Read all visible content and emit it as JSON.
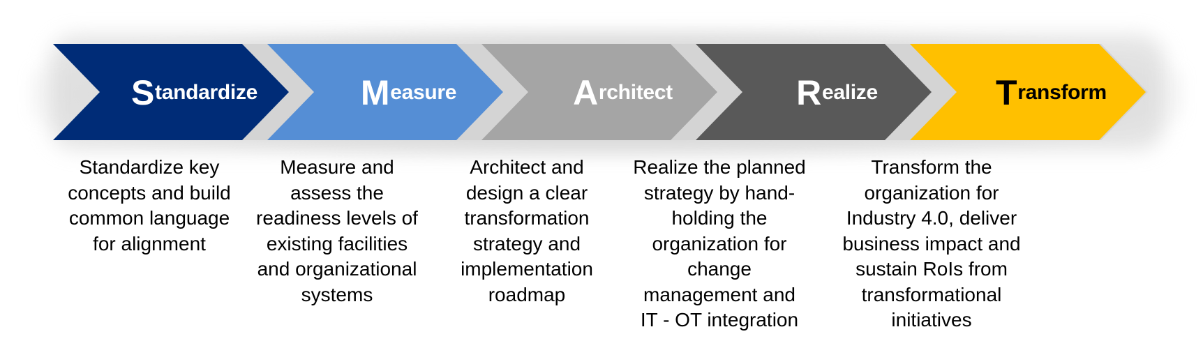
{
  "diagram": {
    "type": "process-chevron-flow",
    "steps": [
      {
        "initial": "S",
        "rest": "tandardize",
        "title": "Standardize",
        "fill": "#002C77",
        "text_color": "#FFFFFF",
        "description": "Standardize key concepts and build common language for alignment",
        "lines": [
          "Standardize key",
          "concepts and build",
          "common language",
          "for alignment"
        ]
      },
      {
        "initial": "M",
        "rest": "easure",
        "title": "Measure",
        "fill": "#558ED5",
        "text_color": "#FFFFFF",
        "description": "Measure and assess the readiness levels of existing facilities and organizational systems",
        "lines": [
          "Measure and",
          "assess the",
          "readiness levels of",
          "existing facilities",
          "and organizational",
          "systems"
        ]
      },
      {
        "initial": "A",
        "rest": "rchitect",
        "title": "Architect",
        "fill": "#A5A5A5",
        "text_color": "#FFFFFF",
        "description": "Architect and design a clear transformation strategy and implementation roadmap",
        "lines": [
          "Architect and",
          "design a clear",
          "transformation",
          "strategy and",
          "implementation",
          "roadmap"
        ]
      },
      {
        "initial": "R",
        "rest": "ealize",
        "title": "Realize",
        "fill": "#595959",
        "text_color": "#FFFFFF",
        "description": "Realize the planned strategy by hand-holding the organization for change management and IT - OT integration",
        "lines": [
          "Realize the planned",
          "strategy by hand-",
          "holding the",
          "organization for",
          "change",
          "management and",
          "IT - OT integration"
        ]
      },
      {
        "initial": "T",
        "rest": "ransform",
        "title": "Transform",
        "fill": "#FFC000",
        "text_color": "#000000",
        "description": "Transform the organization for Industry 4.0, deliver business impact and sustain RoIs from transformational initiatives",
        "lines": [
          "Transform the",
          "organization for",
          "Industry 4.0, deliver",
          "business impact and",
          "sustain RoIs from",
          "transformational",
          "initiatives"
        ]
      }
    ],
    "separator_color": "#D4D4D4"
  }
}
